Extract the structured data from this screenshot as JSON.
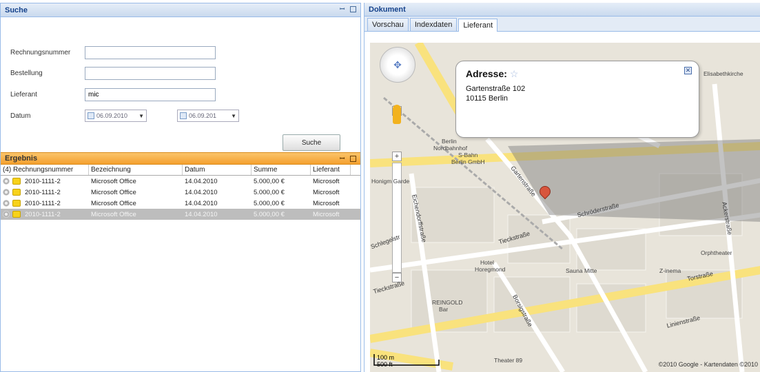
{
  "search_panel": {
    "title": "Suche",
    "fields": {
      "rechnungsnummer": {
        "label": "Rechnungsnummer",
        "value": ""
      },
      "bestellung": {
        "label": "Bestellung",
        "value": ""
      },
      "lieferant": {
        "label": "Lieferant",
        "value": "mic"
      },
      "datum": {
        "label": "Datum",
        "from": "06.09.2010",
        "to": "06.09.201"
      }
    },
    "search_button": "Suche"
  },
  "result_panel": {
    "title": "Ergebnis",
    "columns": [
      "(4) Rechnungsnummer",
      "Bezeichnung",
      "Datum",
      "Summe",
      "Lieferant"
    ],
    "rows": [
      {
        "nr": "2010-1111-2",
        "bez": "Microsoft Office",
        "datum": "14.04.2010",
        "summe": "5.000,00 €",
        "lief": "Microsoft"
      },
      {
        "nr": "2010-1111-2",
        "bez": "Microsoft Office",
        "datum": "14.04.2010",
        "summe": "5.000,00 €",
        "lief": "Microsoft"
      },
      {
        "nr": "2010-1111-2",
        "bez": "Microsoft Office",
        "datum": "14.04.2010",
        "summe": "5.000,00 €",
        "lief": "Microsoft"
      },
      {
        "nr": "2010-1111-2",
        "bez": "Microsoft Office",
        "datum": "14.04.2010",
        "summe": "5.000,00 €",
        "lief": "Microsoft"
      }
    ]
  },
  "document_panel": {
    "title": "Dokument",
    "tabs": [
      "Vorschau",
      "Indexdaten",
      "Lieferant"
    ],
    "active_tab": "Lieferant"
  },
  "map": {
    "bubble_title": "Adresse:",
    "address_line1": "Gartenstraße 102",
    "address_line2": "10115 Berlin",
    "places": {
      "s_bahn": "S-Bahn",
      "s_bahn2": "Berlin GmbH",
      "nordbahnhof": "Berlin",
      "nordbahnhof2": "Nordbahnhof",
      "hotel": "Hotel",
      "hotel2": "Horegmond",
      "reingold": "REINGOLD",
      "reingold2": "Bar",
      "sauna": "Sauna Mitte",
      "orph": "Orphtheater",
      "zinema": "Z-inema",
      "theater": "Theater 89",
      "elisabeth": "Elisabethkirche",
      "garde": "Honigm Garde"
    },
    "streets": {
      "gartenstrasse": "Gartenstraße",
      "schroeder": "Schröderstraße",
      "tieck": "Tieckstraße",
      "tieck2": "Tieckstraße",
      "eichendorff": "Eichendorffstraße",
      "borsig": "Borsigstraße",
      "torstrasse": "Torstraße",
      "linien": "Linienstraße",
      "acker": "Ackerstraße",
      "schlegel": "Schlegelstr"
    },
    "scale_m": "100 m",
    "scale_ft": "500 ft",
    "copyright": "©2010 Google - Kartendaten ©2010"
  },
  "colors": {
    "accent_blue": "#15428b",
    "result_header": "#f4a02f",
    "selected_row": "#bdbdbd"
  }
}
